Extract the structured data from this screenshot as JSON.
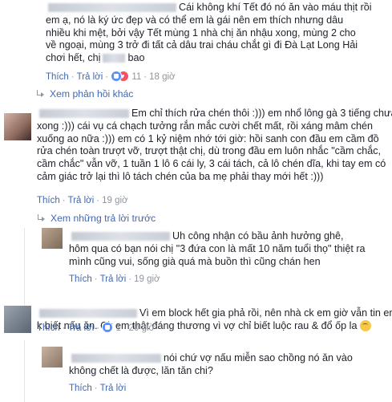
{
  "comments": [
    {
      "text_lines": [
        "Cái không khí Tết đó nó ăn vào máu thịt rồi",
        "em ạ, nó là ký ức đẹp và có thể em là gái nên em thích nhưng dâu",
        "nhiều khi mệt, bởi vậy Tết mùng 1 nhà chị ăn nhậu xong, mùng 2 cho",
        "về ngoại, mùng 3 trở đi tất cả dâu trai cháu chắt gì đi Đà Lạt Long Hải"
      ],
      "last_line_prefix": "chơi hết, chị",
      "last_line_suffix": "bao",
      "like": "Thích",
      "reply": "Trả lời",
      "reaction_count": "11",
      "time": "18 giờ"
    },
    {
      "text_lines": [
        "Em chỉ thích rửa chén thôi :))) em nhổ lông gà 3 tiếng chưa",
        "xong :))) cái vụ cá chạch tưởng rắn mắc cười chết mất, rồi xáng mâm chén",
        "xuống ao nữa :))) em có 1 kỷ niệm nhớ tới giờ: hồi sanh con đầu em cầm đồ",
        "rửa chén toàn trượt vỡ, trượt thật chị, dù trong đầu em luôn nhắc \"cầm chắc,",
        "cầm chắc\" vẫn vỡ, 1 tuần 1 lô 6 cái ly, 3 cái tách, cả lô chén dĩa, khi tay em có",
        "cảm giác trở lại thì lô tách chén của ba mẹ phải thay mới hết :)))"
      ],
      "like": "Thích",
      "reply": "Trả lời",
      "time": "19 giờ"
    },
    {
      "text_lines": [
        "Uh công nhận có bầu ảnh hưởng ghê,",
        "hôm qua có bạn nói chị \"3 đứa con là mất 10 năm tuổi thọ\" thiệt ra",
        "mình cũng vui, sống già quá mà buồn thì cũng chán hen"
      ],
      "like": "Thích",
      "reply": "Trả lời",
      "time": "19 giờ"
    },
    {
      "text_lines": [
        "Vì em block hết gia phả rồi, nên nhà ck em giờ vẫn tin em",
        "k biết nấu ăn. Ck em thật đáng thương vì vợ chỉ biết luộc rau & đổ ốp la"
      ],
      "like": "Thích",
      "reply": "Trả lời",
      "reaction_count": "1",
      "time": "20 giờ"
    },
    {
      "text_lines": [
        "nói chứ vợ nấu miễn sao chồng nó ăn vào",
        "không chết là được, lăn tăn chi?"
      ],
      "like": "Thích",
      "reply": "Trả lời"
    }
  ],
  "more_replies_1": "Xem phản hồi khác",
  "previous_replies": "Xem những trả lời trước",
  "dot": "·"
}
